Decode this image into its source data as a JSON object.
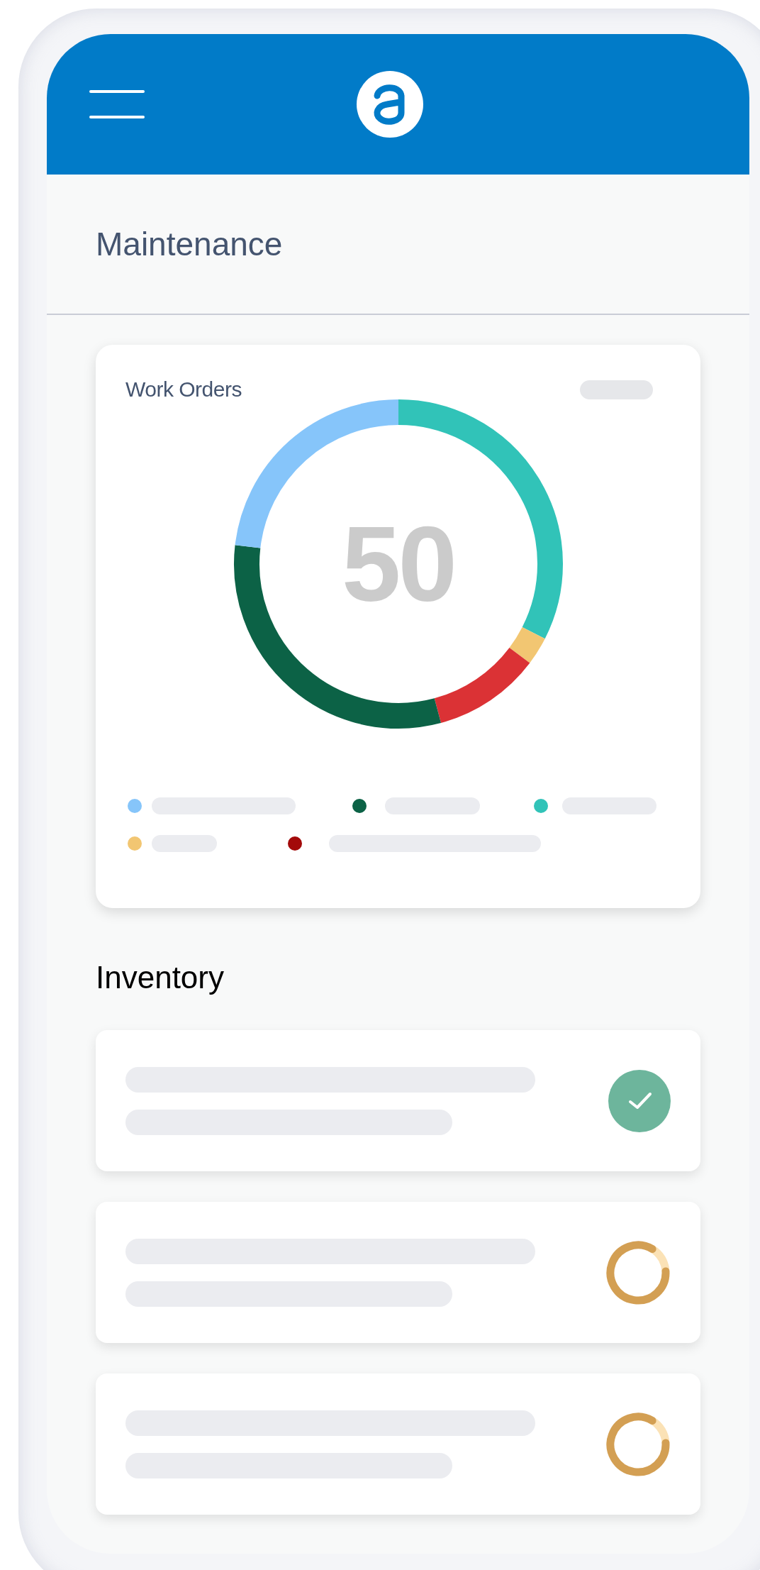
{
  "page_title": "Maintenance",
  "work_orders": {
    "title": "Work Orders",
    "total": "50",
    "legend": [
      {
        "color": "#86c5fa"
      },
      {
        "color": "#0c6246"
      },
      {
        "color": "#31c3b8"
      },
      {
        "color": "#f2c672"
      },
      {
        "color": "#a30a0a"
      }
    ]
  },
  "inventory": {
    "title": "Inventory",
    "items": [
      {
        "kind": "done"
      },
      {
        "kind": "pending"
      },
      {
        "kind": "pending"
      }
    ]
  }
}
